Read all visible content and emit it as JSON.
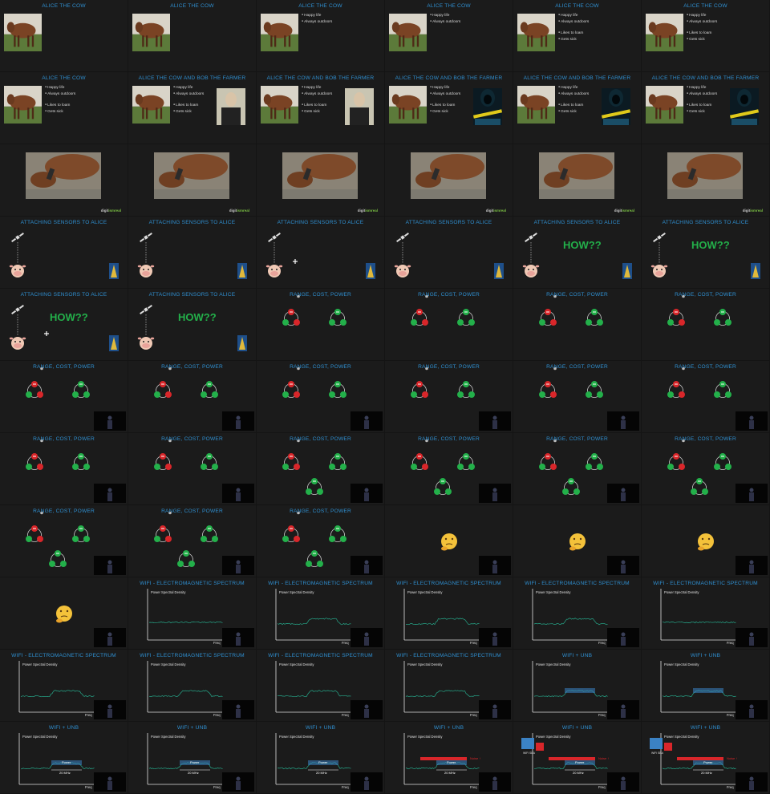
{
  "screen": {
    "background": "#141414",
    "columns": 6,
    "rows": 11
  },
  "text": {
    "alice_title": "ALICE THE COW",
    "alice_bob_title": "ALICE THE COW AND BOB THE FARMER",
    "happy": "Happy life",
    "outdoors": "Always outdoors",
    "loiter": "Likes to loam",
    "sick": "Gets sick",
    "sensors_title": "ATTACHING SENSORS TO ALICE",
    "how": "HOW??",
    "range_title": "RANGE, COST, POWER",
    "spectrum_title": "WIFI - ELECTROMAGNETIC SPECTRUM",
    "wifi_unb_title": "WIFI + UNB",
    "psd_label": "Power Spectral Density",
    "freq_label": "Freq",
    "bw_label": "20 MHz",
    "power_label": "Power",
    "noise_label": "Noise ↑",
    "wifi_side_label": "WiFi SBA",
    "logo_a": "digit",
    "logo_b": "ismreal"
  },
  "colors": {
    "title_blue": "#2f8fd0",
    "green": "#23b04a",
    "red": "#d9262a",
    "trace": "#26a88a",
    "uni_blue": "#3b82c4"
  },
  "cells": [
    {
      "type": "alice",
      "bullets": 0,
      "title": "alice_title"
    },
    {
      "type": "alice",
      "bullets": 0,
      "title": "alice_title"
    },
    {
      "type": "alice",
      "bullets": 1,
      "title": "alice_title"
    },
    {
      "type": "alice",
      "bullets": 1,
      "title": "alice_title"
    },
    {
      "type": "alice",
      "bullets": 2,
      "title": "alice_title"
    },
    {
      "type": "alice",
      "bullets": 2,
      "title": "alice_title"
    },
    {
      "type": "alice",
      "bullets": 2,
      "title": "alice_title"
    },
    {
      "type": "alice",
      "bullets": 2,
      "title": "alice_bob_title",
      "side": "farmer"
    },
    {
      "type": "alice",
      "bullets": 2,
      "title": "alice_bob_title",
      "side": "farmer"
    },
    {
      "type": "alice",
      "bullets": 2,
      "title": "alice_bob_title",
      "side": "hacker"
    },
    {
      "type": "alice",
      "bullets": 2,
      "title": "alice_bob_title",
      "side": "hacker"
    },
    {
      "type": "alice",
      "bullets": 2,
      "title": "alice_bob_title",
      "side": "hacker"
    },
    {
      "type": "photo"
    },
    {
      "type": "photo"
    },
    {
      "type": "photo"
    },
    {
      "type": "photo"
    },
    {
      "type": "photo"
    },
    {
      "type": "photo"
    },
    {
      "type": "sensor",
      "how": false,
      "plus": false
    },
    {
      "type": "sensor",
      "how": false,
      "plus": false
    },
    {
      "type": "sensor",
      "how": false,
      "plus": true
    },
    {
      "type": "sensor",
      "how": false,
      "plus": false
    },
    {
      "type": "sensor",
      "how": true,
      "plus": false
    },
    {
      "type": "sensor",
      "how": true,
      "plus": false
    },
    {
      "type": "sensor",
      "how": true,
      "plus": true
    },
    {
      "type": "sensor",
      "how": true,
      "plus": false
    },
    {
      "type": "tri",
      "third": false,
      "video": false
    },
    {
      "type": "tri",
      "third": false,
      "video": false
    },
    {
      "type": "tri",
      "third": false,
      "video": false
    },
    {
      "type": "tri",
      "third": false,
      "video": false
    },
    {
      "type": "tri",
      "third": false,
      "video": true
    },
    {
      "type": "tri",
      "third": false,
      "video": true
    },
    {
      "type": "tri",
      "third": false,
      "video": true
    },
    {
      "type": "tri",
      "third": false,
      "video": true
    },
    {
      "type": "tri",
      "third": false,
      "video": true
    },
    {
      "type": "tri",
      "third": false,
      "video": true
    },
    {
      "type": "tri",
      "third": false,
      "video": true
    },
    {
      "type": "tri",
      "third": false,
      "video": true
    },
    {
      "type": "tri",
      "third": true,
      "video": true
    },
    {
      "type": "tri",
      "third": true,
      "video": true
    },
    {
      "type": "tri",
      "third": true,
      "video": true
    },
    {
      "type": "tri",
      "third": true,
      "video": true
    },
    {
      "type": "tri",
      "third": true,
      "video": true
    },
    {
      "type": "tri",
      "third": true,
      "video": true
    },
    {
      "type": "tri",
      "third": true,
      "video": true
    },
    {
      "type": "think"
    },
    {
      "type": "think"
    },
    {
      "type": "think"
    },
    {
      "type": "think"
    },
    {
      "type": "spec",
      "hump": 0,
      "uni": 0,
      "title": "spectrum_title"
    },
    {
      "type": "spec",
      "hump": 1,
      "uni": 0,
      "title": "spectrum_title"
    },
    {
      "type": "spec",
      "hump": 1,
      "uni": 0,
      "title": "spectrum_title"
    },
    {
      "type": "spec",
      "hump": 1,
      "uni": 0,
      "title": "spectrum_title"
    },
    {
      "type": "spec",
      "hump": 0,
      "uni": 0,
      "title": "spectrum_title"
    },
    {
      "type": "spec",
      "hump": 1,
      "uni": 0,
      "title": "spectrum_title"
    },
    {
      "type": "spec",
      "hump": 1,
      "uni": 0,
      "title": "spectrum_title"
    },
    {
      "type": "spec",
      "hump": 1,
      "uni": 0,
      "title": "spectrum_title"
    },
    {
      "type": "spec",
      "hump": 1,
      "uni": 0,
      "title": "spectrum_title"
    },
    {
      "type": "spec",
      "hump": 2,
      "uni": 0,
      "title": "wifi_unb_title"
    },
    {
      "type": "spec",
      "hump": 2,
      "uni": 0,
      "title": "wifi_unb_title"
    },
    {
      "type": "spec",
      "hump": 2,
      "uni": 1,
      "title": "wifi_unb_title"
    },
    {
      "type": "spec",
      "hump": 2,
      "uni": 1,
      "title": "wifi_unb_title"
    },
    {
      "type": "spec",
      "hump": 2,
      "uni": 1,
      "title": "wifi_unb_title"
    },
    {
      "type": "spec",
      "hump": 2,
      "uni": 2,
      "title": "wifi_unb_title"
    },
    {
      "type": "spec",
      "hump": 2,
      "uni": 3,
      "title": "wifi_unb_title"
    },
    {
      "type": "spec",
      "hump": 2,
      "uni": 3,
      "title": "wifi_unb_title"
    }
  ]
}
